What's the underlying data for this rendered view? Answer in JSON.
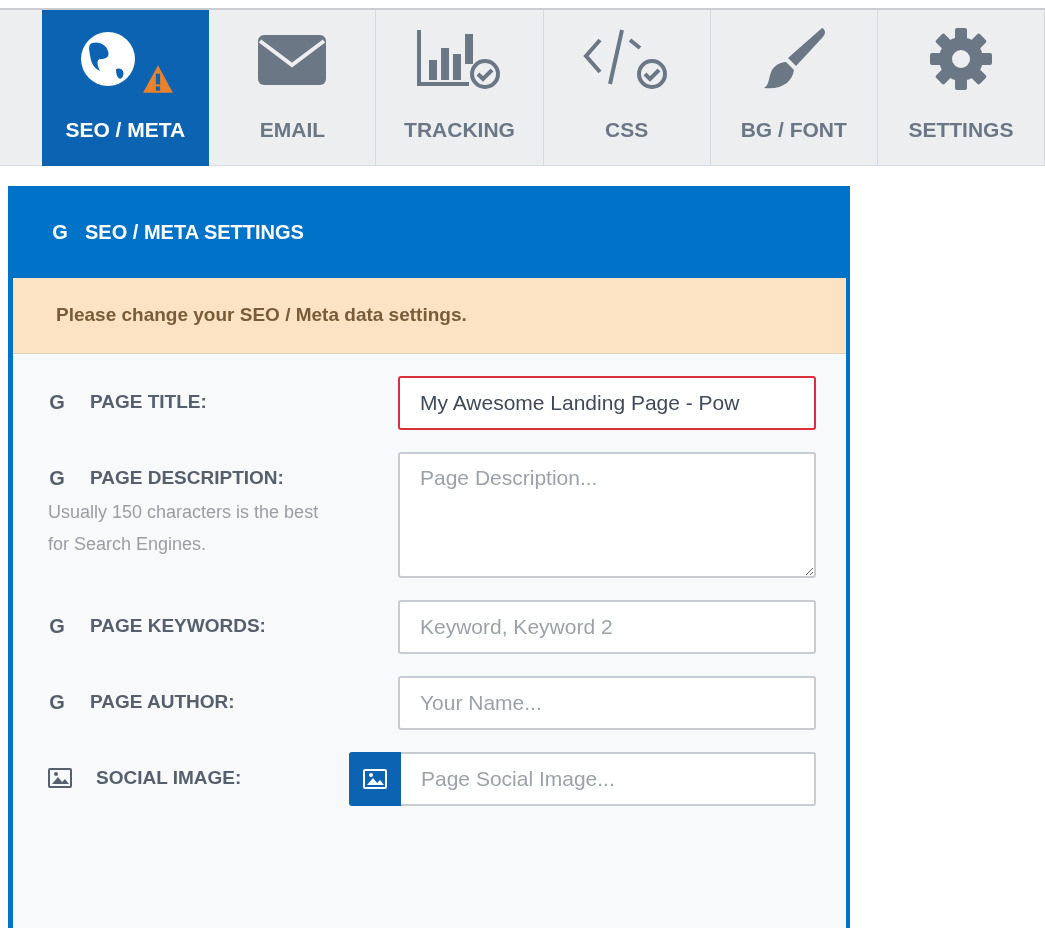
{
  "tabs": [
    {
      "label": "SEO / META",
      "kind": "globe",
      "selected": true,
      "warning": true
    },
    {
      "label": "EMAIL",
      "kind": "envelope",
      "selected": false,
      "warning": false
    },
    {
      "label": "TRACKING",
      "kind": "chart",
      "selected": false,
      "warning": false
    },
    {
      "label": "CSS",
      "kind": "code",
      "selected": false,
      "warning": false
    },
    {
      "label": "BG / FONT",
      "kind": "brush",
      "selected": false,
      "warning": false
    },
    {
      "label": "SETTINGS",
      "kind": "gear",
      "selected": false,
      "warning": false
    }
  ],
  "panel": {
    "header_icon": "G",
    "title": "SEO / META SETTINGS",
    "alert": "Please change your SEO / Meta data settings.",
    "fields": [
      {
        "kind": "text",
        "icon": "G",
        "label": "PAGE TITLE:",
        "value": "My Awesome Landing Page - Pow",
        "invalid": true
      },
      {
        "kind": "textarea",
        "icon": "G",
        "label": "PAGE DESCRIPTION:",
        "hint": "Usually 150 characters is the best for Search Engines.",
        "placeholder": "Page Description...",
        "invalid": false
      },
      {
        "kind": "text",
        "icon": "G",
        "label": "PAGE KEYWORDS:",
        "placeholder": "Keyword, Keyword 2",
        "invalid": false
      },
      {
        "kind": "text",
        "icon": "G",
        "label": "PAGE AUTHOR:",
        "placeholder": "Your Name...",
        "invalid": false
      },
      {
        "kind": "image",
        "label": "SOCIAL IMAGE:",
        "placeholder": "Page Social Image...",
        "invalid": false
      }
    ]
  }
}
